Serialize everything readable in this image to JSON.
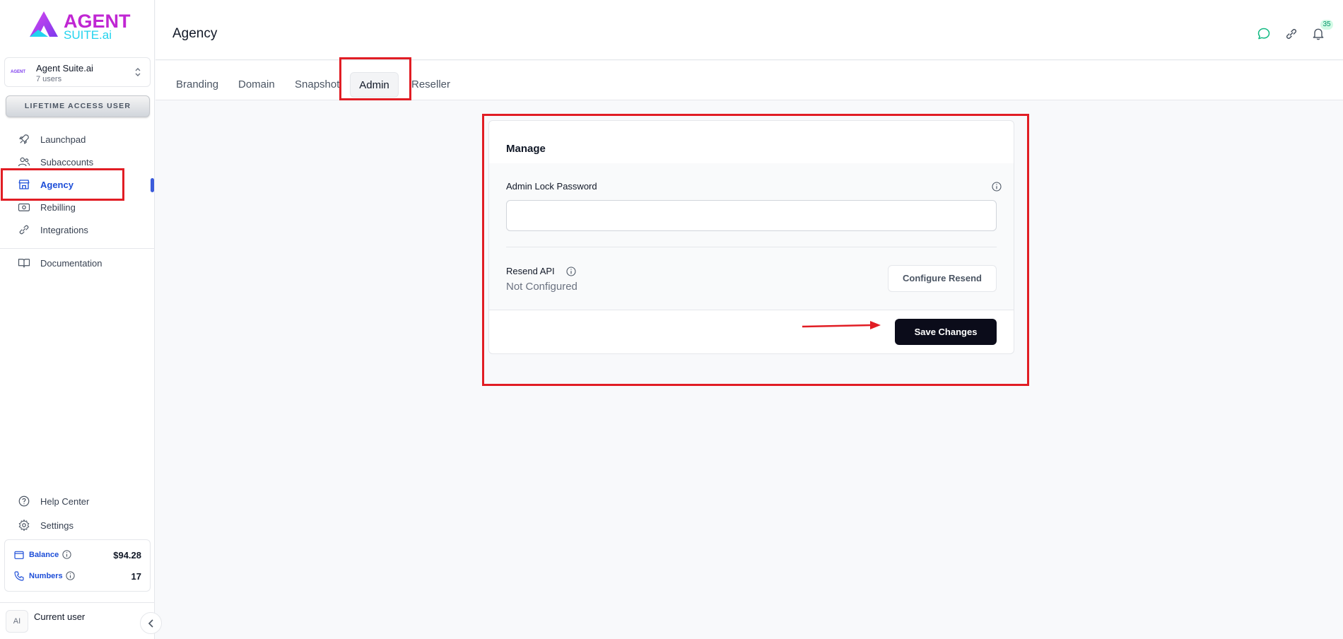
{
  "brand": {
    "line1": "AGENT",
    "line2": "SUITE.ai",
    "mini": "AGENT"
  },
  "workspace": {
    "name": "Agent Suite.ai",
    "users": "7 users"
  },
  "lifetime_badge": "LIFETIME ACCESS USER",
  "sidebar": {
    "items": [
      {
        "label": "Launchpad",
        "icon": "rocket-icon"
      },
      {
        "label": "Subaccounts",
        "icon": "users-icon"
      },
      {
        "label": "Agency",
        "icon": "store-icon",
        "active": true
      },
      {
        "label": "Rebilling",
        "icon": "money-icon"
      },
      {
        "label": "Integrations",
        "icon": "link-icon"
      }
    ],
    "documentation": "Documentation",
    "help": "Help Center",
    "settings": "Settings",
    "balance_label": "Balance",
    "balance_value": "$94.28",
    "numbers_label": "Numbers",
    "numbers_value": "17",
    "avatar": "AI",
    "current_user": "Current user"
  },
  "header": {
    "title": "Agency",
    "notifications": "35"
  },
  "tabs": [
    {
      "label": "Branding"
    },
    {
      "label": "Domain"
    },
    {
      "label": "Snapshot"
    },
    {
      "label": "Admin",
      "active": true
    },
    {
      "label": "Reseller"
    }
  ],
  "card": {
    "title": "Manage",
    "password_label": "Admin Lock Password",
    "password_value": "",
    "resend_label": "Resend API",
    "resend_status": "Not Configured",
    "configure_button": "Configure Resend",
    "save_button": "Save Changes"
  },
  "colors": {
    "accent": "#1d4ed8",
    "highlight": "#e11d24",
    "save_bg": "#0b0c1a",
    "chat_icon": "#10b981"
  }
}
